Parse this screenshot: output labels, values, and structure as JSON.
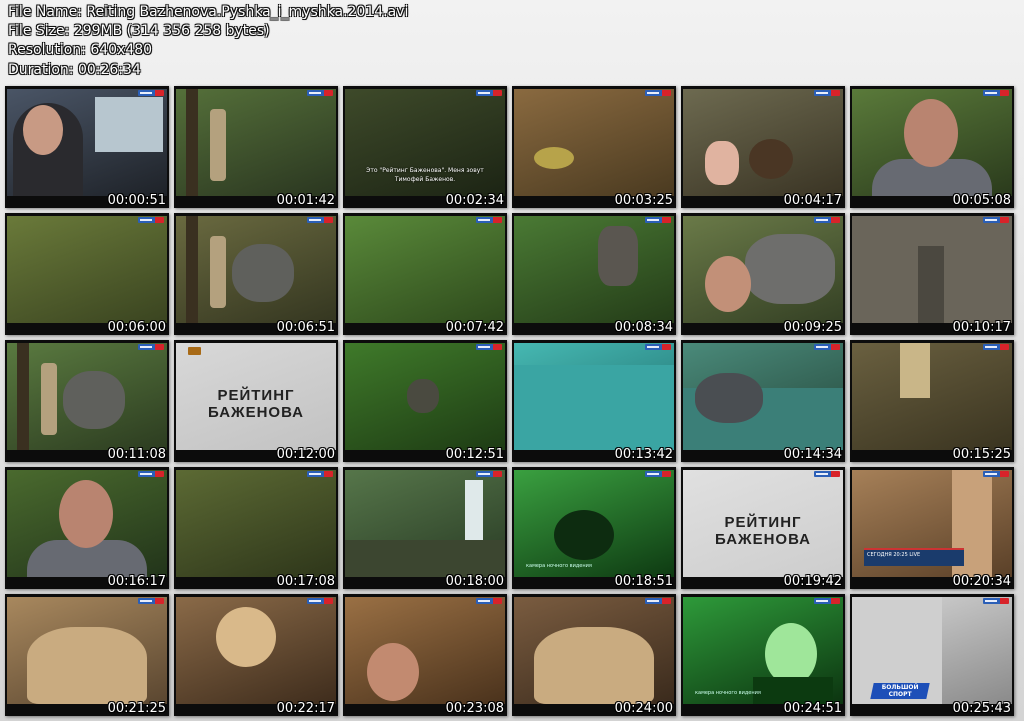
{
  "file_info": {
    "name_line": "File Name: Reiting Bazhenova.Pyshka_i_myshka.2014.avi",
    "size_line": "File Size: 299MB (314 356 258 bytes)",
    "resolution_line": "Resolution: 640x480",
    "duration_line": "Duration: 00:26:34"
  },
  "overlay_text": {
    "brand": "РЕЙТИНГ БАЖЕНОВА",
    "intro_subtitle": "Это \"Рейтинг Баженова\". Меня зовут Тимофей Баженов.",
    "night_vision": "камера ночного видения",
    "news_ticker": "СЕГОДНЯ 20:25 LIVE",
    "sport_logo": "БОЛЬШОЙ СПОРТ"
  },
  "colors": {
    "jungle_dark": "#2d3a1c",
    "jungle_light": "#6f8f3c",
    "mud": "#7a5a34",
    "cave": "#a07a55",
    "night_green": "#1f7a2c",
    "water": "#3aa5a3",
    "channel_blue": "#2b5fb7",
    "channel_red": "#d8232a"
  },
  "thumbnails": [
    {
      "time": "00:00:51",
      "scene": "car-interior",
      "bg": [
        "#4a5566",
        "#1e2228"
      ]
    },
    {
      "time": "00:01:42",
      "scene": "jungle-man",
      "bg": [
        "#55703a",
        "#2a3620"
      ]
    },
    {
      "time": "00:02:34",
      "scene": "intro-subtitle",
      "bg": [
        "#3e4a2a",
        "#1c2414"
      ]
    },
    {
      "time": "00:03:25",
      "scene": "mud-pool",
      "bg": [
        "#8a6a40",
        "#4a3a20"
      ]
    },
    {
      "time": "00:04:17",
      "scene": "hand-dung",
      "bg": [
        "#6d6a50",
        "#3a3424"
      ]
    },
    {
      "time": "00:05:08",
      "scene": "host-closeup",
      "bg": [
        "#5a7a3a",
        "#2a3a1c"
      ]
    },
    {
      "time": "00:06:00",
      "scene": "jungle-floor",
      "bg": [
        "#6a7a3a",
        "#3a4420"
      ]
    },
    {
      "time": "00:06:51",
      "scene": "elephant-path",
      "bg": [
        "#6a6a40",
        "#343620"
      ]
    },
    {
      "time": "00:07:42",
      "scene": "jungle-leaves",
      "bg": [
        "#5a8a3a",
        "#2e4a1c"
      ]
    },
    {
      "time": "00:08:34",
      "scene": "elephant-trunk",
      "bg": [
        "#4a7a34",
        "#243c18"
      ]
    },
    {
      "time": "00:09:25",
      "scene": "host-elephant",
      "bg": [
        "#6a7a48",
        "#344024"
      ]
    },
    {
      "time": "00:10:17",
      "scene": "elephant-skin",
      "bg": [
        "#5e5a4a",
        "#3a362c"
      ]
    },
    {
      "time": "00:11:08",
      "scene": "man-elephant",
      "bg": [
        "#5a7a40",
        "#2c3c20"
      ]
    },
    {
      "time": "00:12:00",
      "scene": "brand-card",
      "bg": [
        "#d8d8d8",
        "#c2c2c2"
      ]
    },
    {
      "time": "00:12:51",
      "scene": "jungle-elephant",
      "bg": [
        "#3f7a2a",
        "#1e3c14"
      ]
    },
    {
      "time": "00:13:42",
      "scene": "turquoise-water",
      "bg": [
        "#46b8b2",
        "#1d6a6a"
      ]
    },
    {
      "time": "00:14:34",
      "scene": "elephant-bath",
      "bg": [
        "#4a8a7a",
        "#24463a"
      ]
    },
    {
      "time": "00:15:25",
      "scene": "muddy-legs",
      "bg": [
        "#6a6040",
        "#3a3420"
      ]
    },
    {
      "time": "00:16:17",
      "scene": "host-forest",
      "bg": [
        "#4a6a2e",
        "#22341a"
      ]
    },
    {
      "time": "00:17:08",
      "scene": "bamboo",
      "bg": [
        "#5c6a34",
        "#2e361a"
      ]
    },
    {
      "time": "00:18:00",
      "scene": "waterfall",
      "bg": [
        "#56764a",
        "#283a24"
      ]
    },
    {
      "time": "00:18:51",
      "scene": "night-cave",
      "bg": [
        "#3aa040",
        "#0e3a12"
      ]
    },
    {
      "time": "00:19:42",
      "scene": "brand-card",
      "bg": [
        "#e0e0e0",
        "#cdcdcd"
      ]
    },
    {
      "time": "00:20:34",
      "scene": "cave-news",
      "bg": [
        "#a68058",
        "#5a4028"
      ]
    },
    {
      "time": "00:21:25",
      "scene": "stalactites",
      "bg": [
        "#a8885e",
        "#5a4630"
      ]
    },
    {
      "time": "00:22:17",
      "scene": "cave-entrance",
      "bg": [
        "#8a6a48",
        "#3e2c1c"
      ]
    },
    {
      "time": "00:23:08",
      "scene": "cave-selfie",
      "bg": [
        "#9a7044",
        "#4a321c"
      ]
    },
    {
      "time": "00:24:00",
      "scene": "stalagmite",
      "bg": [
        "#7a5c40",
        "#3a2a1c"
      ]
    },
    {
      "time": "00:24:51",
      "scene": "night-host",
      "bg": [
        "#2e9a3a",
        "#0c3410"
      ]
    },
    {
      "time": "00:25:43",
      "scene": "sport-cave",
      "bg": [
        "#d6d6d6",
        "#8a8a8a"
      ]
    }
  ]
}
